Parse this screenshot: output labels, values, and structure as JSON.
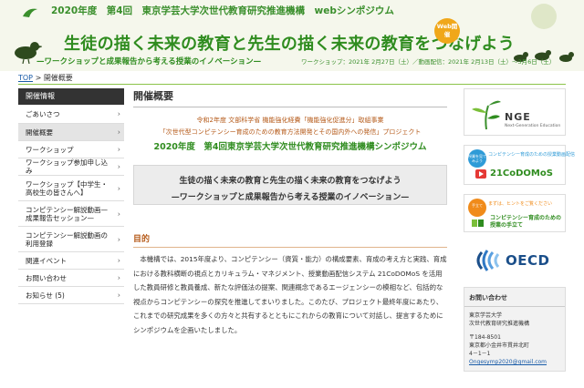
{
  "header": {
    "top_line": "2020年度　第4回　東京学芸大学次世代教育研究推進機構　webシンポジウム",
    "main_title": "生徒の描く未来の教育と先生の描く未来の教育をつなげよう",
    "subtitle": "—ワークショップと成果報告から考える授業のイノベーション—",
    "dates": "ワークショップ：2021年 2月27日（土）／動画配信：2021年 2月13日（土）～3月6日（土）",
    "badge": "Web開催"
  },
  "breadcrumb": {
    "home": "TOP",
    "separator": ">",
    "current": "開催概要"
  },
  "sidebar": {
    "heading": "開催情報",
    "items": [
      {
        "label": "ごあいさつ"
      },
      {
        "label": "開催概要"
      },
      {
        "label": "ワークショップ"
      },
      {
        "label": "ワークショップ参加申し込み"
      },
      {
        "label": "ワークショップ【中学生・高校生の皆さんへ】"
      },
      {
        "label": "コンピテンシー解説動画—成果報告セッション—"
      },
      {
        "label": "コンピテンシー解説動画の利用登録"
      },
      {
        "label": "関連イベント"
      },
      {
        "label": "お問い合わせ"
      },
      {
        "label": "お知らせ (5)"
      }
    ],
    "chevron": "›"
  },
  "main": {
    "title": "開催概要",
    "lead1": "令和2年度 文部科学省 機能強化経費「機能強化促進分」取組事業",
    "lead2": "「次世代型コンピテンシー育成のための教育方法開発とその国内外への発信」プロジェクト",
    "lead3": "2020年度　第4回東京学芸大学次世代教育研究推進機構シンポジウム",
    "theme1": "生徒の描く未来の教育と先生の描く未来の教育をつなげよう",
    "theme2": "—ワークショップと成果報告から考える授業のイノベーション—",
    "purpose_heading": "目的",
    "purpose_body": "本機構では、2015年度より、コンピテンシー（資質・能力）の構成要素、育成の考え方と実践、育成における教科横断の視点とカリキュラム・マネジメント、授業動画配信システム 21CoDOMoS を活用した教員研修と教員養成、新たな評価法の提案、関連概念であるエージェンシーの模相など、包括的な視点からコンピテンシーの探究を推進してまいりました。このたび、プロジェクト最終年度にあたり、これまでの研究成果を多くの方々と共有するとともにこれからの教育について対話し、提言するためにシンポジウムを企画いたしました。"
  },
  "right": {
    "nge_title": "NGE",
    "nge_caption": "Next-Generation Education",
    "codomos_tag": "授業を見てみよう",
    "codomos_note": "コンピテンシー育成のための授業動画配信",
    "codomos_title": "21CoDOMoS",
    "handbook_tag": "手立て",
    "handbook_note": "まずは、ヒントをご覧ください",
    "handbook_title": "コンピテンシー育成のための授業の手立て",
    "oecd_label": "OECD",
    "contact_heading": "お問い合わせ",
    "contact_org": "東京学芸大学",
    "contact_dept": "次世代教育研究推進機構",
    "contact_zip": "〒184-8501",
    "contact_addr": "東京都小金井市貫井北町",
    "contact_addr2": "4－1－1",
    "contact_email": "Ongesymp2020@gmail.com"
  },
  "colors": {
    "brand_green": "#2f8c1f",
    "accent_orange": "#b55a19",
    "link_blue": "#1a5ca8"
  }
}
